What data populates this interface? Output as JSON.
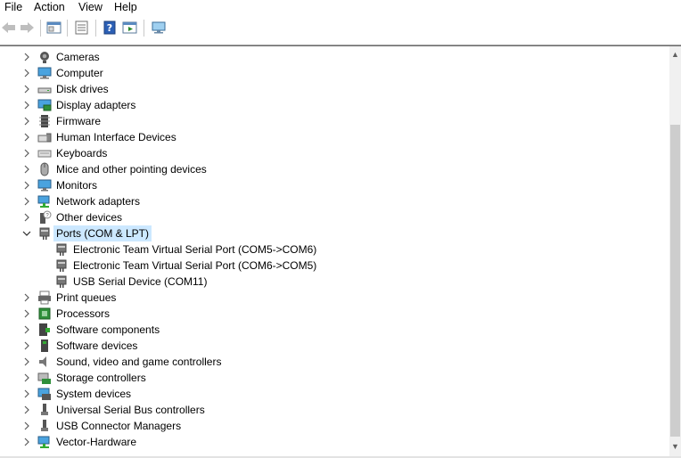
{
  "menu": {
    "file": "File",
    "action": "Action",
    "view": "View",
    "help": "Help"
  },
  "toolbar": {
    "buttons": [
      "back-icon",
      "forward-icon",
      "properties-pane-icon",
      "list-icon",
      "help-icon",
      "run-icon",
      "monitor-icon"
    ]
  },
  "tree": {
    "items": [
      {
        "label": "Cameras",
        "icon": "camera-icon"
      },
      {
        "label": "Computer",
        "icon": "computer-icon"
      },
      {
        "label": "Disk drives",
        "icon": "disk-drive-icon"
      },
      {
        "label": "Display adapters",
        "icon": "display-adapter-icon"
      },
      {
        "label": "Firmware",
        "icon": "firmware-icon"
      },
      {
        "label": "Human Interface Devices",
        "icon": "hid-icon"
      },
      {
        "label": "Keyboards",
        "icon": "keyboard-icon"
      },
      {
        "label": "Mice and other pointing devices",
        "icon": "mouse-icon"
      },
      {
        "label": "Monitors",
        "icon": "monitor-icon"
      },
      {
        "label": "Network adapters",
        "icon": "network-adapter-icon"
      },
      {
        "label": "Other devices",
        "icon": "other-devices-icon"
      },
      {
        "label": "Ports (COM & LPT)",
        "icon": "port-icon",
        "expanded": true,
        "selected": true
      },
      {
        "label": "Electronic Team Virtual Serial Port (COM5->COM6)",
        "icon": "port-icon",
        "child": true
      },
      {
        "label": "Electronic Team Virtual Serial Port (COM6->COM5)",
        "icon": "port-icon",
        "child": true
      },
      {
        "label": "USB Serial Device (COM11)",
        "icon": "port-icon",
        "child": true
      },
      {
        "label": "Print queues",
        "icon": "printer-icon"
      },
      {
        "label": "Processors",
        "icon": "processor-icon"
      },
      {
        "label": "Software components",
        "icon": "software-component-icon"
      },
      {
        "label": "Software devices",
        "icon": "software-device-icon"
      },
      {
        "label": "Sound, video and game controllers",
        "icon": "sound-icon"
      },
      {
        "label": "Storage controllers",
        "icon": "storage-controller-icon"
      },
      {
        "label": "System devices",
        "icon": "system-devices-icon"
      },
      {
        "label": "Universal Serial Bus controllers",
        "icon": "usb-icon"
      },
      {
        "label": "USB Connector Managers",
        "icon": "usb-icon"
      },
      {
        "label": "Vector-Hardware",
        "icon": "network-adapter-icon"
      }
    ]
  }
}
